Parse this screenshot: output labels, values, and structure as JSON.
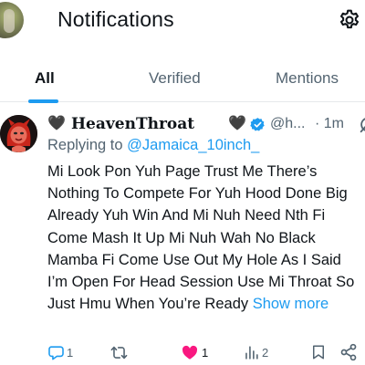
{
  "header": {
    "title": "Notifications",
    "settings_icon": "gear-icon"
  },
  "tabs": [
    {
      "label": "All",
      "active": true
    },
    {
      "label": "Verified",
      "active": false
    },
    {
      "label": "Mentions",
      "active": false
    }
  ],
  "tweet": {
    "name_prefix_emoji": "🖤",
    "display_name": "HeavenThroat",
    "name_suffix_emoji": "🖤",
    "verified": true,
    "handle": "@h...",
    "time": "· 1m",
    "replying_to_label": "Replying to",
    "replying_to_handle": "@Jamaica_10inch_",
    "text": "Mi Look Pon Yuh Page Trust Me There’s Nothing To Compete For Yuh Hood Done Big Already Yuh Win And Mi Nuh Need Nth Fi Come Mash It Up Mi Nuh Wah No Black Mamba Fi Come Use Out My Hole As I Said I’m Open For Head Session Use Mi Throat So Just Hmu When You’re Ready ",
    "show_more": "Show more",
    "actions": {
      "replies": "1",
      "retweets": "",
      "likes": "1",
      "views": "2"
    },
    "colors": {
      "accent": "#1d9bf0",
      "like": "#f91880",
      "muted": "#536471"
    }
  }
}
